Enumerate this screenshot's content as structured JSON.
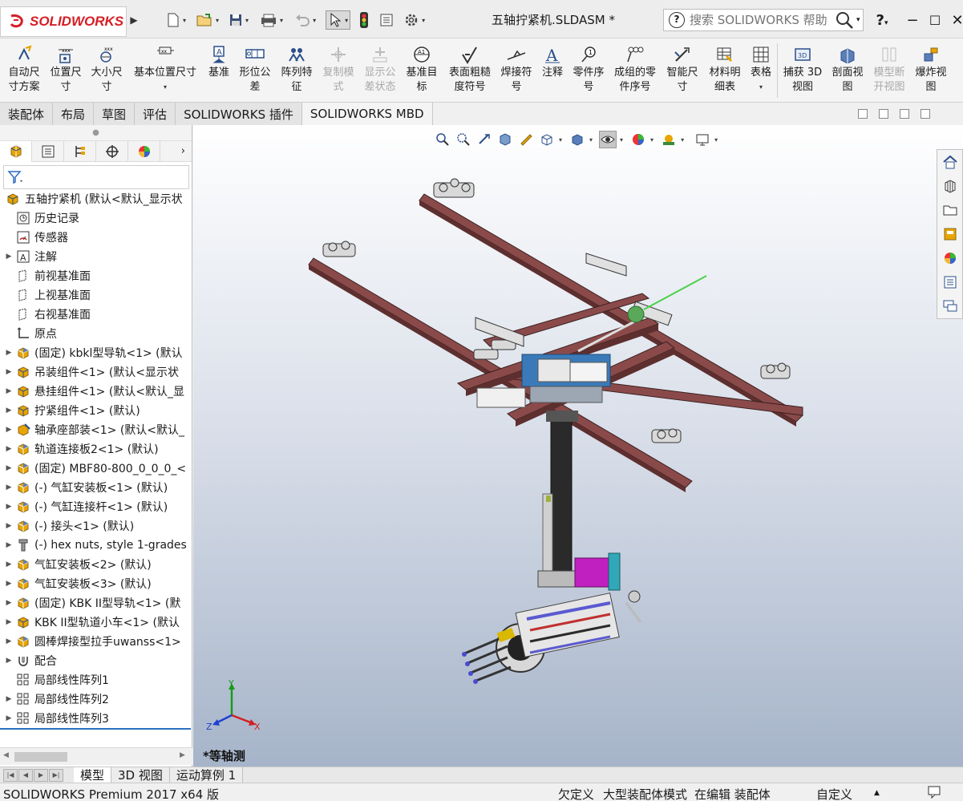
{
  "app": {
    "logo_text": "SOLIDWORKS",
    "doc_title": "五轴拧紧机.SLDASM *",
    "help_placeholder": "搜索 SOLIDWORKS 帮助",
    "help_q": "?"
  },
  "commands": [
    {
      "label": "自动尺寸方案",
      "lines": [
        "自动尺",
        "寸方案"
      ],
      "icon": "auto-dimension-icon",
      "disabled": false
    },
    {
      "label": "位置尺寸",
      "lines": [
        "位置尺",
        "寸"
      ],
      "icon": "location-dimension-icon",
      "disabled": false
    },
    {
      "label": "大小尺寸",
      "lines": [
        "大小尺",
        "寸"
      ],
      "icon": "size-dimension-icon",
      "disabled": false
    },
    {
      "label": "基本位置尺寸",
      "lines": [
        "基本位置尺寸",
        ""
      ],
      "icon": "basic-location-dimension-icon",
      "disabled": false
    },
    {
      "label": "基准",
      "lines": [
        "基准",
        ""
      ],
      "icon": "datum-icon",
      "disabled": false
    },
    {
      "label": "形位公差",
      "lines": [
        "形位公",
        "差"
      ],
      "icon": "geometric-tolerance-icon",
      "disabled": false
    },
    {
      "label": "阵列特征",
      "lines": [
        "阵列特",
        "征"
      ],
      "icon": "pattern-feature-icon",
      "disabled": false
    },
    {
      "label": "复制模式",
      "lines": [
        "复制模",
        "式"
      ],
      "icon": "copy-scheme-icon",
      "disabled": true
    },
    {
      "label": "显示公差状态",
      "lines": [
        "显示公",
        "差状态"
      ],
      "icon": "show-tolerance-status-icon",
      "disabled": true
    },
    {
      "label": "基准目标",
      "lines": [
        "基准目",
        "标"
      ],
      "icon": "datum-target-icon",
      "disabled": false
    },
    {
      "label": "表面粗糙度符号",
      "lines": [
        "表面粗糙",
        "度符号"
      ],
      "icon": "surface-finish-icon",
      "disabled": false
    },
    {
      "label": "焊接符号",
      "lines": [
        "焊接符",
        "号"
      ],
      "icon": "weld-symbol-icon",
      "disabled": false
    },
    {
      "label": "注释",
      "lines": [
        "注释",
        ""
      ],
      "icon": "note-icon",
      "disabled": false
    },
    {
      "label": "零件序号",
      "lines": [
        "零件序",
        "号"
      ],
      "icon": "balloon-icon",
      "disabled": false
    },
    {
      "label": "成组的零件序号",
      "lines": [
        "成组的零",
        "件序号"
      ],
      "icon": "stacked-balloon-icon",
      "disabled": false
    },
    {
      "label": "智能尺寸",
      "lines": [
        "智能尺",
        "寸"
      ],
      "icon": "smart-dimension-icon",
      "disabled": false
    },
    {
      "label": "材料明细表",
      "lines": [
        "材料明",
        "细表"
      ],
      "icon": "bom-icon",
      "disabled": false
    },
    {
      "label": "表格",
      "lines": [
        "表格",
        ""
      ],
      "icon": "table-icon",
      "disabled": false
    },
    {
      "label": "捕获 3D 视图",
      "lines": [
        "捕获 3D",
        "视图"
      ],
      "icon": "capture-3d-view-icon",
      "disabled": false
    },
    {
      "label": "剖面视图",
      "lines": [
        "剖面视",
        "图"
      ],
      "icon": "section-view-icon",
      "disabled": false
    },
    {
      "label": "模型断开视图",
      "lines": [
        "模型断",
        "开视图"
      ],
      "icon": "model-break-view-icon",
      "disabled": true
    },
    {
      "label": "爆炸视图",
      "lines": [
        "爆炸视",
        "图"
      ],
      "icon": "exploded-view-icon",
      "disabled": false
    }
  ],
  "tabs": [
    "装配体",
    "布局",
    "草图",
    "评估",
    "SOLIDWORKS 插件",
    "SOLIDWORKS MBD"
  ],
  "active_tab": "SOLIDWORKS MBD",
  "tree": [
    {
      "text": "五轴拧紧机 (默认<默认_显示状",
      "icon": "assembly-icon",
      "expand": "",
      "root": true
    },
    {
      "text": "历史记录",
      "icon": "history-icon",
      "expand": ""
    },
    {
      "text": "传感器",
      "icon": "sensor-icon",
      "expand": ""
    },
    {
      "text": "注解",
      "icon": "annotation-icon",
      "expand": "▶"
    },
    {
      "text": "前视基准面",
      "icon": "plane-icon",
      "expand": ""
    },
    {
      "text": "上视基准面",
      "icon": "plane-icon",
      "expand": ""
    },
    {
      "text": "右视基准面",
      "icon": "plane-icon",
      "expand": ""
    },
    {
      "text": "原点",
      "icon": "origin-icon",
      "expand": ""
    },
    {
      "text": "(固定) kbkl型导轨<1> (默认",
      "icon": "part-icon",
      "expand": "▶"
    },
    {
      "text": "吊装组件<1> (默认<显示状",
      "icon": "subassembly-icon",
      "expand": "▶"
    },
    {
      "text": "悬挂组件<1> (默认<默认_显",
      "icon": "subassembly-icon",
      "expand": "▶"
    },
    {
      "text": "拧紧组件<1> (默认)",
      "icon": "subassembly-icon",
      "expand": "▶"
    },
    {
      "text": "轴承座部装<1> (默认<默认_",
      "icon": "subassembly-edit-icon",
      "expand": "▶"
    },
    {
      "text": "轨道连接板2<1> (默认)",
      "icon": "part-icon",
      "expand": "▶"
    },
    {
      "text": "(固定) MBF80-800_0_0_0_<",
      "icon": "part-icon",
      "expand": "▶"
    },
    {
      "text": "(-) 气缸安装板<1> (默认)",
      "icon": "part-icon",
      "expand": "▶"
    },
    {
      "text": "(-) 气缸连接杆<1> (默认)",
      "icon": "part-icon",
      "expand": "▶"
    },
    {
      "text": "(-) 接头<1> (默认)",
      "icon": "part-icon",
      "expand": "▶"
    },
    {
      "text": "(-) hex nuts, style 1-grades",
      "icon": "toolbox-icon",
      "expand": "▶"
    },
    {
      "text": "气缸安装板<2> (默认)",
      "icon": "part-icon",
      "expand": "▶"
    },
    {
      "text": "气缸安装板<3> (默认)",
      "icon": "part-icon",
      "expand": "▶"
    },
    {
      "text": "(固定) KBK II型导轨<1> (默",
      "icon": "part-icon",
      "expand": "▶"
    },
    {
      "text": "KBK II型轨道小车<1> (默认",
      "icon": "subassembly-icon",
      "expand": "▶"
    },
    {
      "text": "圆棒焊接型拉手uwanss<1>",
      "icon": "part-icon",
      "expand": "▶"
    },
    {
      "text": "配合",
      "icon": "mates-icon",
      "expand": "▶"
    },
    {
      "text": "局部线性阵列1",
      "icon": "linear-pattern-icon",
      "expand": ""
    },
    {
      "text": "局部线性阵列2",
      "icon": "linear-pattern-icon",
      "expand": "▶"
    },
    {
      "text": "局部线性阵列3",
      "icon": "linear-pattern-icon",
      "expand": "▶"
    }
  ],
  "viewport": {
    "view_label": "*等轴测",
    "axis_x": "X",
    "axis_y": "Y",
    "axis_z": "Z"
  },
  "bottom_tabs": [
    "模型",
    "3D 视图",
    "运动算例 1"
  ],
  "active_bottom_tab": "模型",
  "status": {
    "product": "SOLIDWORKS Premium 2017 x64 版",
    "underdefined": "欠定义",
    "large_assembly": "大型装配体模式",
    "editing": "在编辑 装配体",
    "custom": "自定义"
  },
  "colors": {
    "brand_red": "#d51f26",
    "rail": "#8b4a4a",
    "accent_blue": "#2b6fc2"
  }
}
